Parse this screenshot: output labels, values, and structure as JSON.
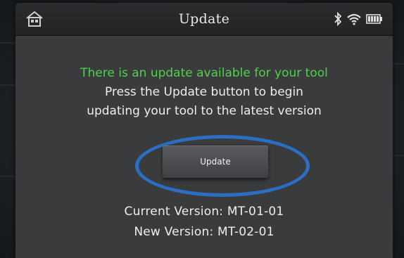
{
  "header": {
    "title": "Update",
    "icons": [
      "home-icon",
      "bluetooth-icon",
      "wifi-icon",
      "battery-icon"
    ]
  },
  "message": {
    "line_green": "There is an update available for your tool",
    "line_1": "Press the Update button to begin",
    "line_2": "updating your tool to the latest version"
  },
  "update_button": {
    "label": "Update"
  },
  "versions": {
    "current": "Current Version: MT-01-01",
    "new": "New Version: MT-02-01"
  },
  "colors": {
    "accent_green": "#4fd24a",
    "highlight_oval": "#2a6fc4",
    "screen_bg": "#3a3b3d"
  }
}
